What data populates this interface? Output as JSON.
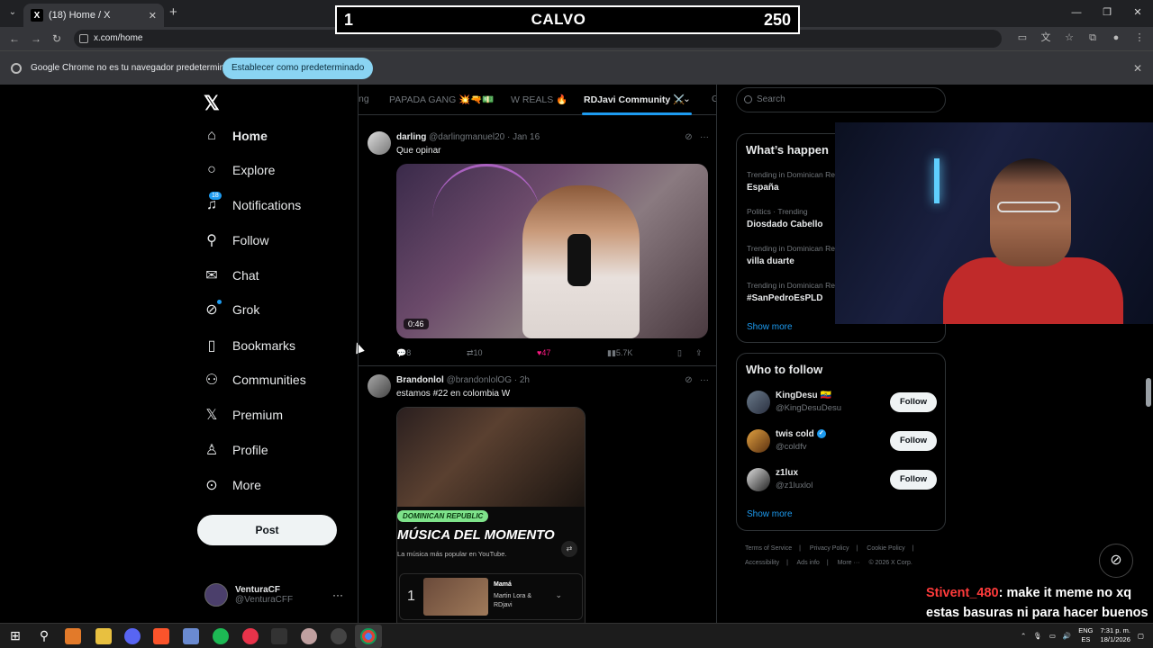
{
  "browser": {
    "tab_title": "(18) Home / X",
    "tab_favicon": "X",
    "url": "x.com/home",
    "infobar_text": "Google Chrome no es tu navegador predeterminado",
    "infobar_button": "Establecer como predeterminado"
  },
  "scoreboard": {
    "left": "1",
    "name": "CALVO",
    "right": "250"
  },
  "nav": {
    "items": [
      {
        "label": "Home",
        "icon": "home-icon"
      },
      {
        "label": "Explore",
        "icon": "search-icon"
      },
      {
        "label": "Notifications",
        "icon": "bell-icon",
        "badge": "18"
      },
      {
        "label": "Follow",
        "icon": "person-add-icon"
      },
      {
        "label": "Chat",
        "icon": "mail-icon"
      },
      {
        "label": "Grok",
        "icon": "grok-icon"
      },
      {
        "label": "Bookmarks",
        "icon": "bookmark-icon"
      },
      {
        "label": "Communities",
        "icon": "communities-icon"
      },
      {
        "label": "Premium",
        "icon": "x-icon"
      },
      {
        "label": "Profile",
        "icon": "person-icon"
      },
      {
        "label": "More",
        "icon": "more-circle-icon"
      }
    ],
    "post_label": "Post",
    "account_name": "VenturaCF",
    "account_handle": "@VenturaCFF"
  },
  "feed": {
    "tabs": [
      "ng",
      "PAPADA GANG 💥🔫💵",
      "W REALS 🔥",
      "RDJavi Community ⚔️",
      "G"
    ],
    "tweets": [
      {
        "name": "darling",
        "meta": "@darlingmanuel20 · Jan 16",
        "text": "Que opinar",
        "duration": "0:46",
        "replies": "8",
        "reposts": "10",
        "likes": "47",
        "views": "5.7K"
      },
      {
        "name": "Brandonlol",
        "meta": "@brandonlolOG · 2h",
        "text": "estamos #22 en colombia W",
        "card": {
          "badge": "DOMINICAN REPUBLIC",
          "title": "MÚSICA DEL MOMENTO",
          "subtitle": "La música más popular en YouTube.",
          "rank": "1",
          "song": "Mamá",
          "artist": "Martin Lora & RDjavi"
        }
      }
    ]
  },
  "right": {
    "search_placeholder": "Search",
    "trends_title": "What’s happen",
    "trends": [
      {
        "category": "Trending in Dominican Re",
        "name": "España"
      },
      {
        "category": "Politics · Trending",
        "name": "Diosdado Cabello"
      },
      {
        "category": "Trending in Dominican Re",
        "name": "villa duarte"
      },
      {
        "category": "Trending in Dominican Re",
        "name": "#SanPedroEsPLD"
      }
    ],
    "show_more": "Show more",
    "wtf_title": "Who to follow",
    "wtf": [
      {
        "name": "KingDesu 🇪🇨",
        "handle": "@KingDesuDesu",
        "button": "Follow"
      },
      {
        "name": "twis cold",
        "handle": "@coldfv",
        "button": "Follow"
      },
      {
        "name": "z1lux",
        "handle": "@z1luxlol",
        "button": "Follow"
      }
    ],
    "footer": [
      "Terms of Service",
      "|",
      "Privacy Policy",
      "|",
      "Cookie Policy",
      "|",
      "Accessibility",
      "|",
      "Ads info",
      "|",
      "More ···",
      "© 2026 X Corp."
    ]
  },
  "chat": {
    "user": "Stivent_480",
    "message": ": make it meme no xq estas basuras ni para hacer buenos memes sirven"
  },
  "taskbar": {
    "lang_top": "ENG",
    "lang_bottom": "ES",
    "time": "7:31 p. m.",
    "date": "18/1/2026"
  }
}
